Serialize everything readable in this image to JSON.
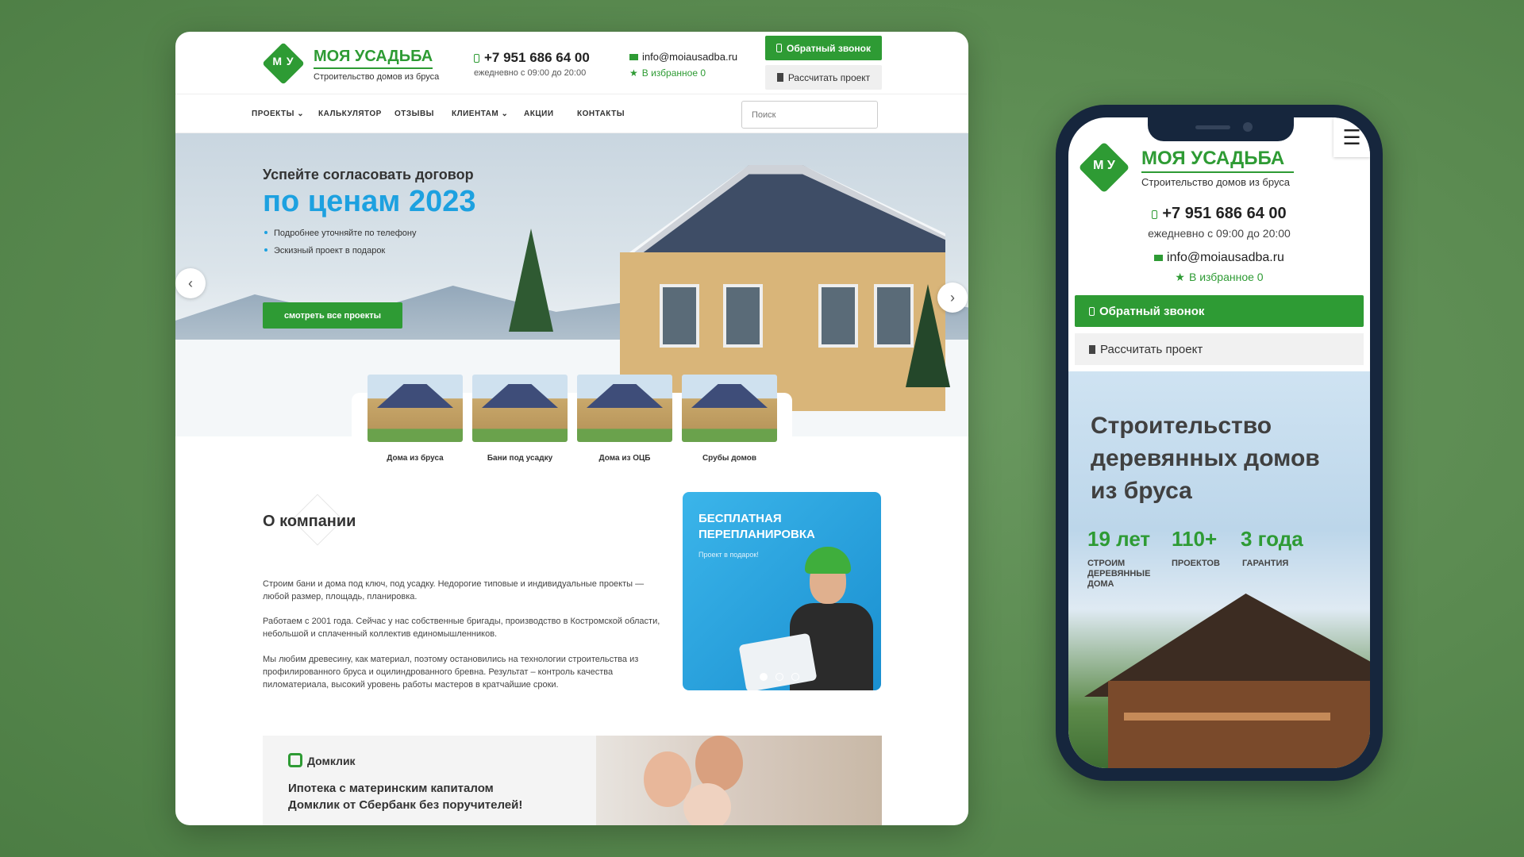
{
  "colors": {
    "brand_green": "#2e9b34",
    "accent_blue": "#1da1e0",
    "background": "#5a8a50"
  },
  "desktop": {
    "logo": {
      "mark": "М У",
      "title": "МОЯ УСАДЬБА",
      "subtitle": "Строительство домов из бруса"
    },
    "contacts": {
      "phone": "+7 951 686 64 00",
      "hours": "ежедневно с 09:00 до 20:00",
      "email": "info@moiausadba.ru",
      "favorites": "В избранное 0"
    },
    "buttons": {
      "callback": "Обратный звонок",
      "calculate": "Рассчитать проект"
    },
    "nav": [
      "ПРОЕКТЫ ⌄",
      "КАЛЬКУЛЯТОР",
      "ОТЗЫВЫ",
      "КЛИЕНТАМ ⌄",
      "АКЦИИ",
      "КОНТАКТЫ"
    ],
    "search_placeholder": "Поиск",
    "hero": {
      "title1": "Успейте согласовать договор",
      "title2": "по ценам 2023",
      "bullets": [
        "Подробнее уточняйте по телефону",
        "Эскизный проект в подарок"
      ],
      "button": "смотреть все проекты",
      "prev": "‹",
      "next": "›"
    },
    "categories": [
      "Дома из бруса",
      "Бани под усадку",
      "Дома из ОЦБ",
      "Срубы домов"
    ],
    "about": {
      "title": "О компании",
      "paragraphs": [
        "Строим бани и дома под ключ, под усадку. Недорогие типовые и индивидуальные проекты — любой размер, площадь, планировка.",
        "Работаем с 2001 года. Сейчас у нас собственные бригады, производство в Костромской области, небольшой и сплаченный коллектив единомышленников.",
        "Мы любим древесину, как материал, поэтому остановились на технологии строительства из профилированного бруса и оцилиндрованного бревна. Результат – контроль качества пиломатериала, высокий уровень работы мастеров в кратчайшие сроки."
      ]
    },
    "promo": {
      "title": "БЕСПЛАТНАЯ ПЕРЕПЛАНИРОВКА",
      "subtitle": "Проект в подарок!",
      "slides": 3,
      "active_slide": 1
    },
    "banner": {
      "brand": "Домклик",
      "line1": "Ипотека с материнским капиталом",
      "line2": "Домклик от Сбербанк без поручителей!"
    }
  },
  "mobile": {
    "logo": {
      "mark": "М У",
      "title": "МОЯ УСАДЬБА",
      "subtitle": "Строительство домов из бруса"
    },
    "menu_icon": "☰",
    "contacts": {
      "phone": "+7 951 686 64 00",
      "hours": "ежедневно с 09:00 до 20:00",
      "email": "info@moiausadba.ru",
      "favorites": "В избранное 0"
    },
    "buttons": {
      "callback": "Обратный звонок",
      "calculate": "Рассчитать проект"
    },
    "hero": {
      "title": "Строительство деревянных домов из бруса",
      "stats": [
        {
          "value": "19 лет",
          "label": "СТРОИМ ДЕРЕВЯННЫЕ ДОМА"
        },
        {
          "value": "110+",
          "label": "ПРОЕКТОВ"
        },
        {
          "value": "3 года",
          "label": "ГАРАНТИЯ"
        }
      ]
    }
  }
}
